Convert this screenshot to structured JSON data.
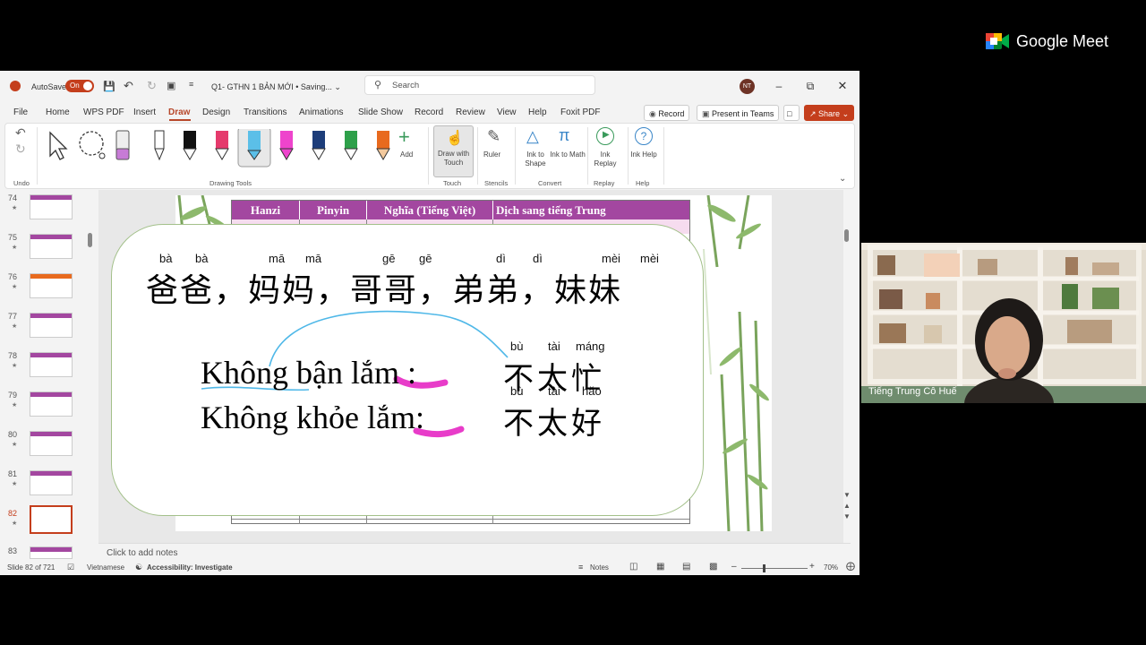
{
  "meet": {
    "brand": "Google Meet",
    "participant_name": "Tiếng Trung Cô Huế"
  },
  "titlebar": {
    "autosave_label": "AutoSave",
    "autosave_state": "On",
    "doc_title": "Q1- GTHN 1 BẢN MỚI • Saving...",
    "search_placeholder": "Search",
    "avatar_initials": "NT"
  },
  "menu": {
    "items": [
      "File",
      "Home",
      "WPS PDF",
      "Insert",
      "Draw",
      "Design",
      "Transitions",
      "Animations",
      "Slide Show",
      "Record",
      "Review",
      "View",
      "Help",
      "Foxit PDF"
    ],
    "active": "Draw",
    "record_label": "Record",
    "present_label": "Present in Teams",
    "share_label": "Share"
  },
  "ribbon": {
    "undo_label": "Undo",
    "drawing_tools_label": "Drawing Tools",
    "add_label": "Add",
    "draw_with_touch": "Draw with Touch",
    "touch_group": "Touch",
    "ruler": "Ruler",
    "stencils_group": "Stencils",
    "ink_to_shape": "Ink to Shape",
    "ink_to_math": "Ink to Math",
    "convert_group": "Convert",
    "ink_replay": "Ink Replay",
    "replay_group": "Replay",
    "ink_help": "Ink Help",
    "help_group": "Help"
  },
  "thumbnails": [
    {
      "num": "74"
    },
    {
      "num": "75"
    },
    {
      "num": "76"
    },
    {
      "num": "77"
    },
    {
      "num": "78"
    },
    {
      "num": "79"
    },
    {
      "num": "80"
    },
    {
      "num": "81"
    },
    {
      "num": "82",
      "selected": true
    },
    {
      "num": "83"
    }
  ],
  "slide": {
    "table_headers": [
      "Hanzi",
      "Pinyin",
      "Nghĩa (Tiếng Việt)",
      "Dịch sang tiếng Trung"
    ],
    "line1_pinyin": [
      "bà",
      "bà",
      "mā",
      "mā",
      "gē",
      "gē",
      "dì",
      "dì",
      "mèi",
      "mèi"
    ],
    "line1_hanzi": "爸爸，妈妈，哥哥，弟弟，妹妹",
    "line2_viet": "Không bận lắm :",
    "line2_hanzi": "不太忙",
    "line2_pinyin": [
      "bù",
      "tài",
      "máng"
    ],
    "line3_viet": "Không khỏe lắm:",
    "line3_hanzi": "不太好",
    "line3_pinyin": [
      "bù",
      "tài",
      "hǎo"
    ],
    "colors": {
      "header": "#a347a0",
      "highlight": "#e83cc9",
      "ink": "#4fb8e8"
    }
  },
  "notes_placeholder": "Click to add notes",
  "status": {
    "slide_info": "Slide 82 of 721",
    "language": "Vietnamese",
    "accessibility": "Accessibility: Investigate",
    "notes": "Notes",
    "zoom": "70%"
  }
}
